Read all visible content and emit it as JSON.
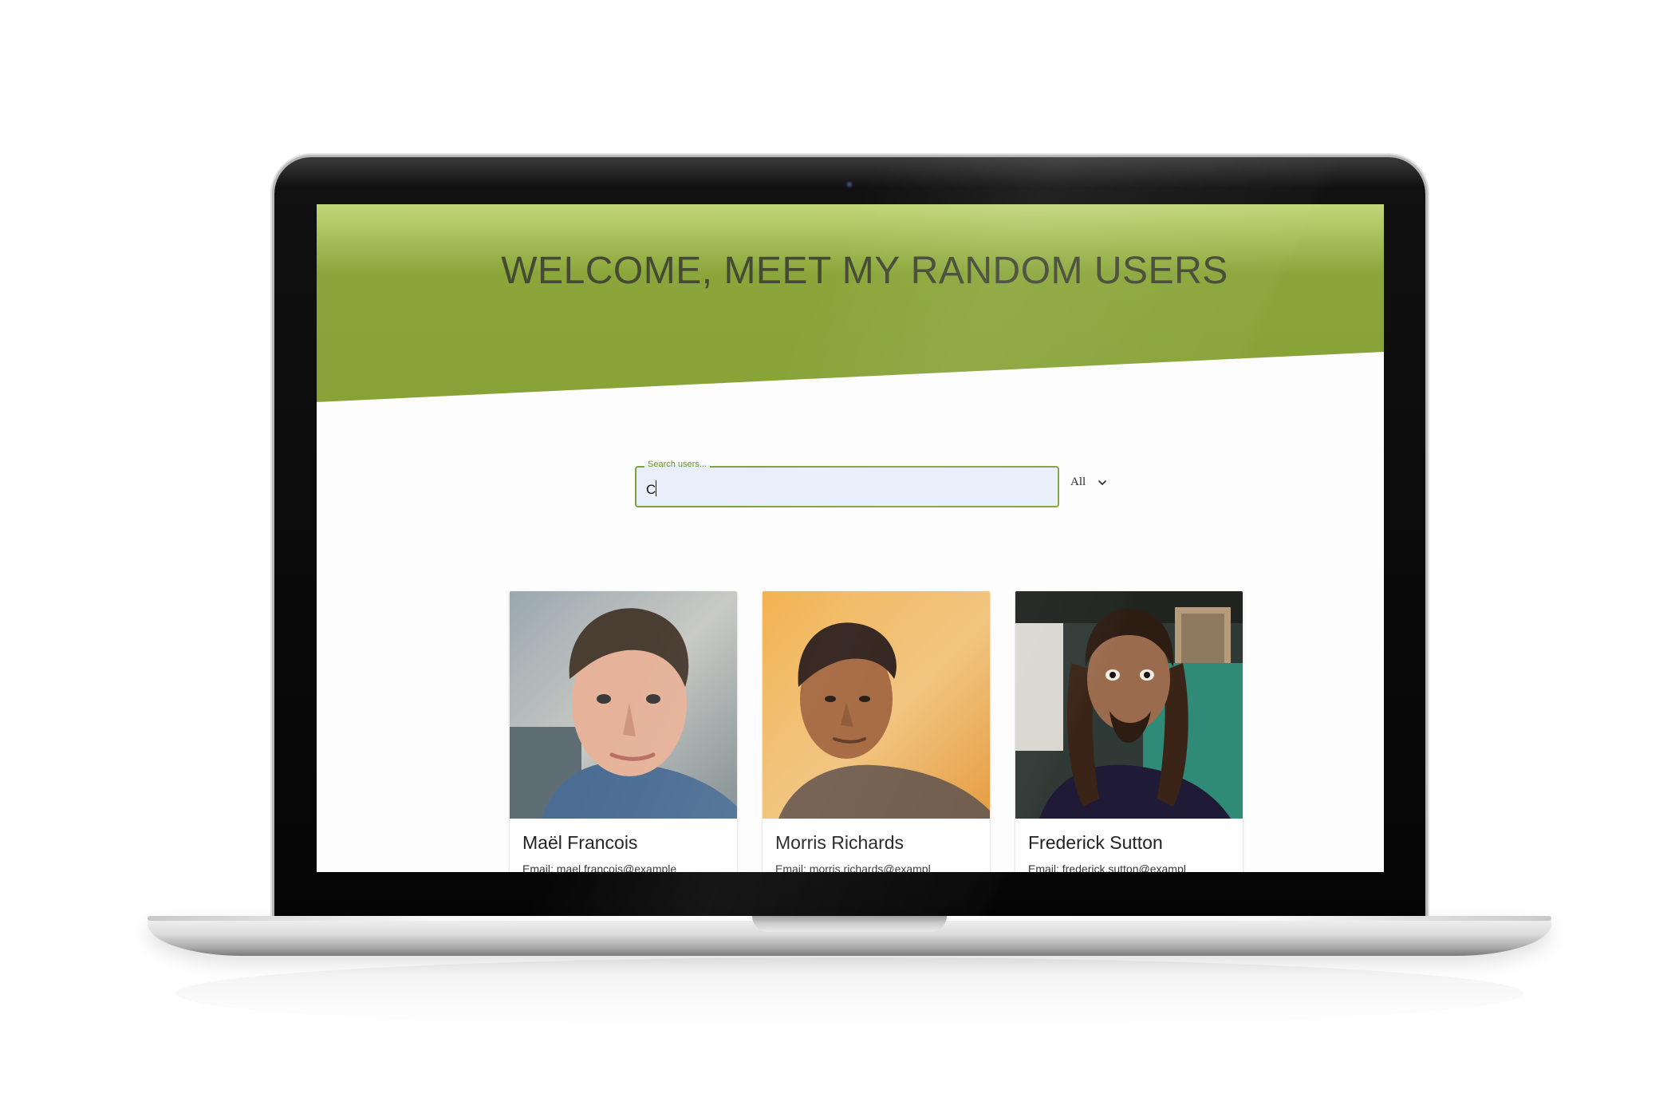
{
  "page": {
    "title": "WELCOME, MEET MY RANDOM USERS"
  },
  "search": {
    "label": "Search users...",
    "value": "C"
  },
  "filter": {
    "selected": "All"
  },
  "users": [
    {
      "name": "Maël Francois",
      "email": "Email: mael.francois@example"
    },
    {
      "name": "Morris Richards",
      "email": "Email: morris.richards@exampl"
    },
    {
      "name": "Frederick Sutton",
      "email": "Email: frederick.sutton@exampl"
    }
  ],
  "colors": {
    "hero_green": "#8aa63a",
    "hero_green_light": "#c2d67a",
    "title_text": "#454a35",
    "input_border": "#7fa33a",
    "input_fill": "#e8effb"
  },
  "icons": {
    "filter_dropdown": "chevron-down-icon",
    "webcam": "camera-icon"
  }
}
